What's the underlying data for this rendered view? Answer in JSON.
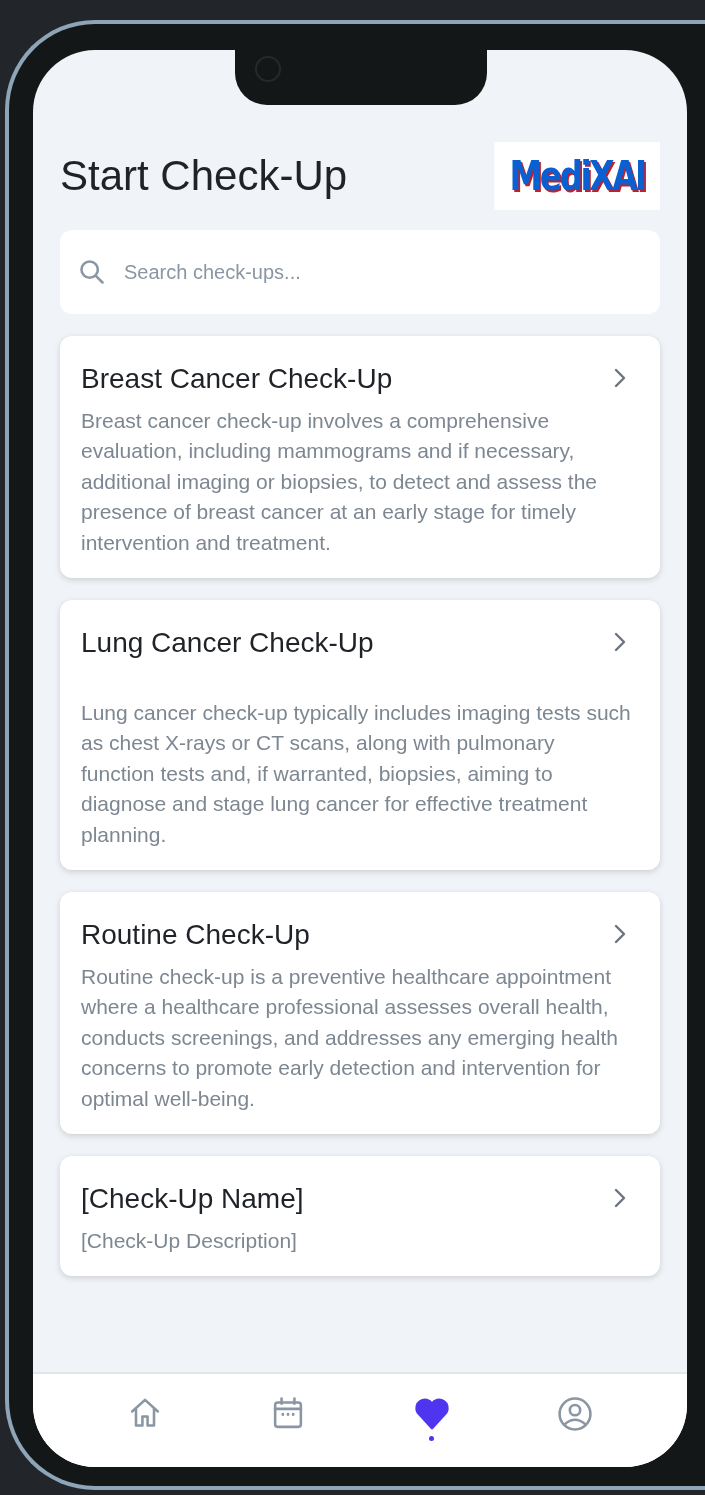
{
  "header": {
    "title": "Start Check-Up",
    "logo": "MediXAI"
  },
  "search": {
    "placeholder": "Search check-ups..."
  },
  "checkups": [
    {
      "name": "Breast Cancer Check-Up",
      "description": "Breast cancer check-up involves a comprehensive evaluation, including mammograms and if necessary, additional imaging or biopsies, to detect and assess the presence of breast cancer at an early stage for timely intervention and treatment."
    },
    {
      "name": "Lung Cancer Check-Up",
      "description": "Lung cancer check-up typically includes imaging tests such as chest X-rays or CT scans, along with pulmonary function tests and, if warranted, biopsies, aiming to diagnose and stage lung cancer for effective treatment planning."
    },
    {
      "name": "Routine Check-Up",
      "description": "Routine check-up is a preventive healthcare appointment where a healthcare professional assesses overall health, conducts screenings, and addresses any emerging health concerns to promote early detection and intervention for optimal well-being."
    },
    {
      "name": "[Check-Up Name]",
      "description": "[Check-Up Description]"
    }
  ],
  "bottom_nav": [
    {
      "kind": "home",
      "selected": false
    },
    {
      "kind": "calendar",
      "selected": false
    },
    {
      "kind": "heart",
      "selected": true
    },
    {
      "kind": "profile",
      "selected": false
    }
  ]
}
